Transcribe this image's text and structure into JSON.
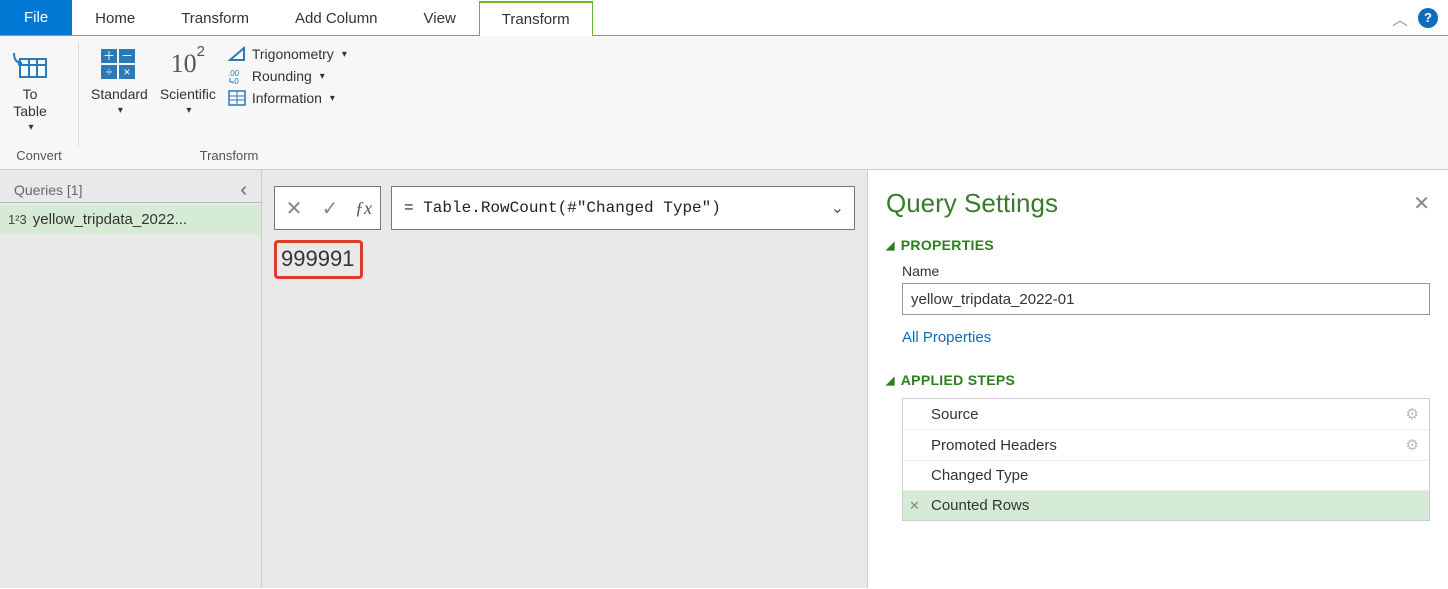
{
  "tabs": {
    "file": "File",
    "list": [
      "Home",
      "Transform",
      "Add Column",
      "View",
      "Transform"
    ],
    "activeIndex": 4
  },
  "ribbon": {
    "convert": {
      "label": "Convert",
      "toTable": "To\nTable"
    },
    "transform": {
      "label": "Transform",
      "standard": "Standard",
      "scientific": "Scientific",
      "sciGlyph": "10",
      "sciExp": "2",
      "trig": "Trigonometry",
      "rounding": "Rounding",
      "info": "Information"
    }
  },
  "queries": {
    "header": "Queries [1]",
    "items": [
      "yellow_tripdata_2022..."
    ]
  },
  "formula": {
    "text": "= Table.RowCount(#\"Changed Type\")",
    "result": "999991"
  },
  "settings": {
    "title": "Query Settings",
    "propsHeader": "PROPERTIES",
    "nameLabel": "Name",
    "nameValue": "yellow_tripdata_2022-01",
    "allProps": "All Properties",
    "stepsHeader": "APPLIED STEPS",
    "steps": [
      {
        "label": "Source",
        "gear": true
      },
      {
        "label": "Promoted Headers",
        "gear": true
      },
      {
        "label": "Changed Type",
        "gear": false
      },
      {
        "label": "Counted Rows",
        "gear": false,
        "selected": true,
        "deletable": true
      }
    ]
  }
}
